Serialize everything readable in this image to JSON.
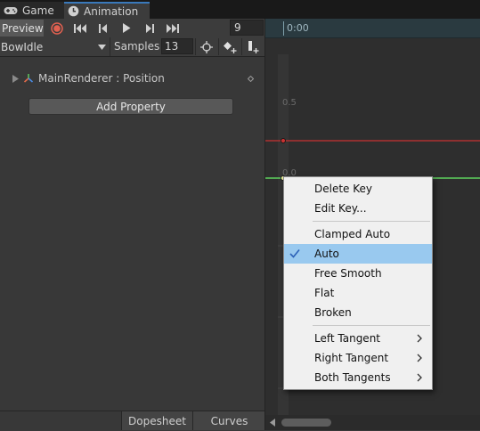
{
  "tabs": [
    {
      "label": "Game",
      "icon": "gamepad-icon"
    },
    {
      "label": "Animation",
      "icon": "clock-icon"
    }
  ],
  "toolbar": {
    "preview_label": "Preview",
    "record_icon": "record-icon",
    "first_key_icon": "skip-to-start-icon",
    "prev_key_icon": "step-back-icon",
    "play_icon": "play-icon",
    "next_key_icon": "step-forward-icon",
    "last_key_icon": "skip-to-end-icon",
    "frame_value": "9"
  },
  "clip_bar": {
    "clip_name": "BowIdle",
    "samples_label": "Samples",
    "samples_value": "13",
    "snap_icon": "crosshair-icon",
    "add_keyframe_icon": "add-keyframe-icon",
    "add_event_icon": "add-event-icon"
  },
  "properties": [
    {
      "label": "MainRenderer : Position"
    }
  ],
  "add_property_label": "Add Property",
  "view_tabs": {
    "dopesheet": "Dopesheet",
    "curves": "Curves"
  },
  "timeline": {
    "start_time": "0:00",
    "y_labels": [
      "0.5",
      "0.0"
    ]
  },
  "colors": {
    "curve_red": "#c83232",
    "curve_green": "#5fd35f",
    "accent_blue": "#3a79bb",
    "checkmark": "#2d62b8"
  },
  "context_menu": {
    "items": [
      {
        "label": "Delete Key",
        "checked": false,
        "submenu": false
      },
      {
        "label": "Edit Key...",
        "checked": false,
        "submenu": false
      },
      {
        "label": "Clamped Auto",
        "checked": false,
        "submenu": false
      },
      {
        "label": "Auto",
        "checked": true,
        "submenu": false
      },
      {
        "label": "Free Smooth",
        "checked": false,
        "submenu": false
      },
      {
        "label": "Flat",
        "checked": false,
        "submenu": false
      },
      {
        "label": "Broken",
        "checked": false,
        "submenu": false
      },
      {
        "label": "Left Tangent",
        "checked": false,
        "submenu": true
      },
      {
        "label": "Right Tangent",
        "checked": false,
        "submenu": true
      },
      {
        "label": "Both Tangents",
        "checked": false,
        "submenu": true
      }
    ]
  }
}
